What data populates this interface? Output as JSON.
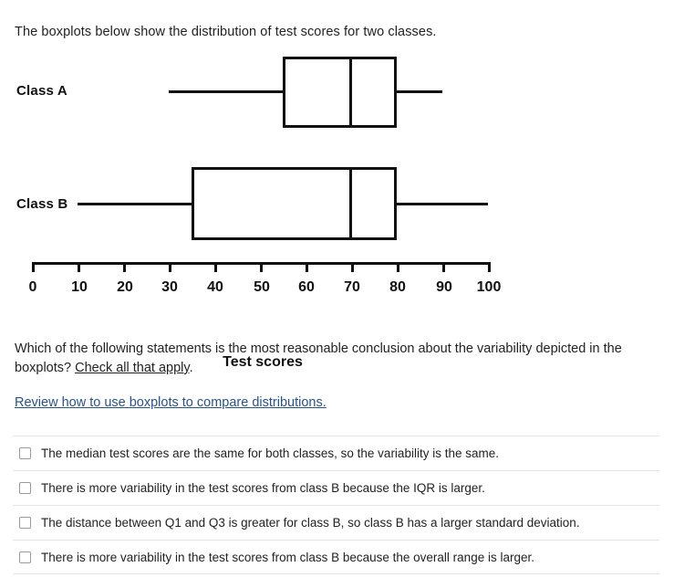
{
  "intro": "The boxplots below show the distribution of test scores for two classes.",
  "chart_data": {
    "type": "boxplot",
    "title": "",
    "xlabel": "Test scores",
    "ylabel": "",
    "xlim": [
      0,
      100
    ],
    "xticks": [
      0,
      10,
      20,
      30,
      40,
      50,
      60,
      70,
      80,
      90,
      100
    ],
    "grid": false,
    "legend": "none",
    "series": [
      {
        "name": "Class A",
        "min": 30,
        "q1": 55,
        "median": 70,
        "q3": 80,
        "max": 90,
        "iqr": 25,
        "range": 60
      },
      {
        "name": "Class B",
        "min": 10,
        "q1": 35,
        "median": 70,
        "q3": 80,
        "max": 100,
        "iqr": 45,
        "range": 90
      }
    ]
  },
  "question": {
    "part1": "Which of the following statements is the most reasonable conclusion about the variability depicted in the boxplots? ",
    "emphasis": "Check all that apply",
    "part2": "."
  },
  "review_link": "Review how to use boxplots to compare distributions.",
  "choices": [
    {
      "label": "The median test scores are the same for both classes, so the variability is the same.",
      "checked": false
    },
    {
      "label": "There is more variability in the test scores from class B because the IQR is larger.",
      "checked": false
    },
    {
      "label": "The distance between Q1 and Q3 is greater for class B, so class B has a larger standard deviation.",
      "checked": false
    },
    {
      "label": "There is more variability in the test scores from class B because the overall range is larger.",
      "checked": false
    }
  ],
  "colors": {
    "link": "#27528f",
    "ink": "#111111",
    "rule": "#e3e3e3"
  }
}
